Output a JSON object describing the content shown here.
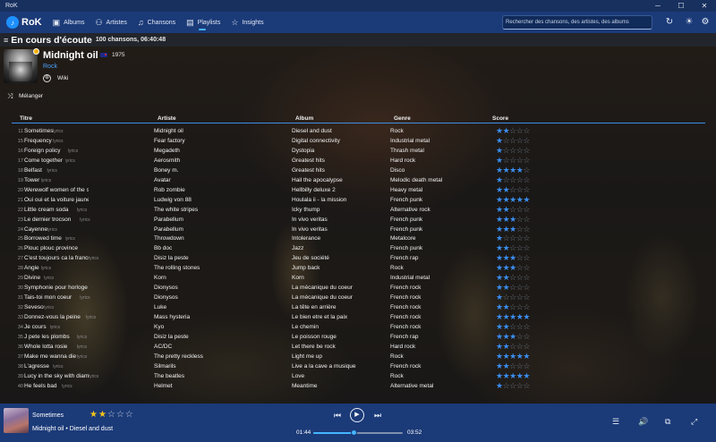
{
  "window": {
    "title": "RoK",
    "minimize": "─",
    "maximize": "☐",
    "close": "✕"
  },
  "nav": {
    "logo_icon": "♪",
    "logo": "RoK",
    "items": [
      {
        "label": "Albums",
        "icon": "album-icon",
        "glyph": "▣"
      },
      {
        "label": "Artistes",
        "icon": "artists-icon",
        "glyph": "⚇"
      },
      {
        "label": "Chansons",
        "icon": "music-note-icon",
        "glyph": "♫"
      },
      {
        "label": "Playlists",
        "icon": "playlist-icon",
        "glyph": "▤"
      },
      {
        "label": "Insights",
        "icon": "star-icon",
        "glyph": "☆"
      }
    ],
    "active_item": "Playlists",
    "search_placeholder": "Rechercher des chansons, des artistes, des albums",
    "refresh_icon": "↻",
    "theme_icon": "☀",
    "settings_icon": "⚙"
  },
  "header": {
    "icon": "≡",
    "title": "En cours d'écoute",
    "count": "100 chansons, 06:40:48"
  },
  "artist": {
    "name": "Midnight oil",
    "year": "1975",
    "genre": "Rock",
    "wiki_label": "Wiki",
    "wiki_icon": "⊕",
    "shuffle_icon": "⤨",
    "shuffle_label": "Mélanger"
  },
  "table": {
    "headers": {
      "title": "Titre",
      "artist": "Artiste",
      "album": "Album",
      "genre": "Genre",
      "score": "Score"
    },
    "lyrics_tag": "lyrics",
    "rows": [
      {
        "num": "11",
        "title": "Sometimes",
        "lyrics": true,
        "artist": "Midnight oil",
        "album": "Diesel and dust",
        "genre": "Rock",
        "score": 2
      },
      {
        "num": "15",
        "title": "Frequency",
        "lyrics": true,
        "artist": "Fear factory",
        "album": "Digital connectivity",
        "genre": "Industrial metal",
        "score": 1
      },
      {
        "num": "16",
        "title": "Foreign policy",
        "lyrics": true,
        "artist": "Megadeth",
        "album": "Dystopia",
        "genre": "Thrash metal",
        "score": 1
      },
      {
        "num": "17",
        "title": "Come together",
        "lyrics": true,
        "artist": "Aerosmith",
        "album": "Greatest hits",
        "genre": "Hard rock",
        "score": 1
      },
      {
        "num": "18",
        "title": "Belfast",
        "lyrics": true,
        "artist": "Boney m.",
        "album": "Greatest hits",
        "genre": "Disco",
        "score": 4
      },
      {
        "num": "19",
        "title": "Tower",
        "lyrics": true,
        "artist": "Avatar",
        "album": "Hail the apocalypse",
        "genre": "Melodic death metal",
        "score": 1
      },
      {
        "num": "20",
        "title": "Werewolf women of the ss",
        "lyrics": false,
        "artist": "Rob zombie",
        "album": "Hellbilly deluxe 2",
        "genre": "Heavy metal",
        "score": 2
      },
      {
        "num": "21",
        "title": "Oui oui et la voiture jaune",
        "lyrics": false,
        "artist": "Ludwig von 88",
        "album": "Houlala ii - la mission",
        "genre": "French punk",
        "score": 5
      },
      {
        "num": "22",
        "title": "Little cream soda",
        "lyrics": true,
        "artist": "The white stripes",
        "album": "Icky thump",
        "genre": "Alternative rock",
        "score": 2
      },
      {
        "num": "23",
        "title": "Le dernier trocson",
        "lyrics": true,
        "artist": "Parabellum",
        "album": "In vivo veritas",
        "genre": "French punk",
        "score": 3
      },
      {
        "num": "24",
        "title": "Cayenne",
        "lyrics": true,
        "artist": "Parabellum",
        "album": "In vivo veritas",
        "genre": "French punk",
        "score": 3
      },
      {
        "num": "25",
        "title": "Borrowed time",
        "lyrics": true,
        "artist": "Throwdown",
        "album": "Intolerance",
        "genre": "Metalcore",
        "score": 1
      },
      {
        "num": "26",
        "title": "Plouc plouc province",
        "lyrics": false,
        "artist": "Bb doc",
        "album": "Jazz",
        "genre": "French punk",
        "score": 2
      },
      {
        "num": "27",
        "title": "C'est toujours ca la france",
        "lyrics": true,
        "artist": "Disiz la peste",
        "album": "Jeu de société",
        "genre": "French rap",
        "score": 3
      },
      {
        "num": "28",
        "title": "Angie",
        "lyrics": true,
        "artist": "The rolling stones",
        "album": "Jump back",
        "genre": "Rock",
        "score": 3
      },
      {
        "num": "29",
        "title": "Divine",
        "lyrics": true,
        "artist": "Korn",
        "album": "Korn",
        "genre": "Industrial metal",
        "score": 2
      },
      {
        "num": "30",
        "title": "Symphonie pour horloge cassée",
        "lyrics": false,
        "artist": "Dionysos",
        "album": "La mécanique du coeur",
        "genre": "French rock",
        "score": 2
      },
      {
        "num": "31",
        "title": "Tais-toi mon coeur",
        "lyrics": true,
        "artist": "Dionysos",
        "album": "La mécanique du coeur",
        "genre": "French rock",
        "score": 1
      },
      {
        "num": "32",
        "title": "Seveso",
        "lyrics": true,
        "artist": "Luke",
        "album": "La tête en arrière",
        "genre": "French rock",
        "score": 2
      },
      {
        "num": "33",
        "title": "Donnez-vous la peine",
        "lyrics": true,
        "artist": "Mass hysteria",
        "album": "Le bien etre et la paix",
        "genre": "French rock",
        "score": 5
      },
      {
        "num": "34",
        "title": "Je cours",
        "lyrics": true,
        "artist": "Kyo",
        "album": "Le chemin",
        "genre": "French rock",
        "score": 2
      },
      {
        "num": "35",
        "title": "J pete les plombs",
        "lyrics": true,
        "artist": "Disiz la peste",
        "album": "Le poisson rouge",
        "genre": "French rap",
        "score": 3
      },
      {
        "num": "36",
        "title": "Whole lotta rosie",
        "lyrics": true,
        "artist": "AC/DC",
        "album": "Let there be rock",
        "genre": "Hard rock",
        "score": 2
      },
      {
        "num": "37",
        "title": "Make me wanna die",
        "lyrics": true,
        "artist": "The pretty reckless",
        "album": "Light me up",
        "genre": "Rock",
        "score": 5
      },
      {
        "num": "38",
        "title": "L'agresse",
        "lyrics": true,
        "artist": "Silmarils",
        "album": "Live a la cave a musique",
        "genre": "French rock",
        "score": 2
      },
      {
        "num": "39",
        "title": "Lucy in the sky with diamonds",
        "lyrics": true,
        "artist": "The beatles",
        "album": "Love",
        "genre": "Rock",
        "score": 5
      },
      {
        "num": "40",
        "title": "He feels bad",
        "lyrics": true,
        "artist": "Helmet",
        "album": "Meantime",
        "genre": "Alternative metal",
        "score": 1
      }
    ]
  },
  "player": {
    "title": "Sometimes",
    "artist": "Midnight oil",
    "separator": "•",
    "album": "Diesel and dust",
    "rating": 2,
    "elapsed": "01:44",
    "duration": "03:52",
    "progress": 0.45,
    "prev_icon": "⏮",
    "play_icon": "▶",
    "next_icon": "⏭",
    "queue_icon": "☰",
    "volume_icon": "🔊",
    "miniplayer_icon": "⧉",
    "fullscreen_icon": "⤢"
  },
  "colors": {
    "accent": "#45b4ff",
    "nav_bg": "#1b3a78",
    "star": "#3a8ef0",
    "player_star": "#f5c518"
  }
}
